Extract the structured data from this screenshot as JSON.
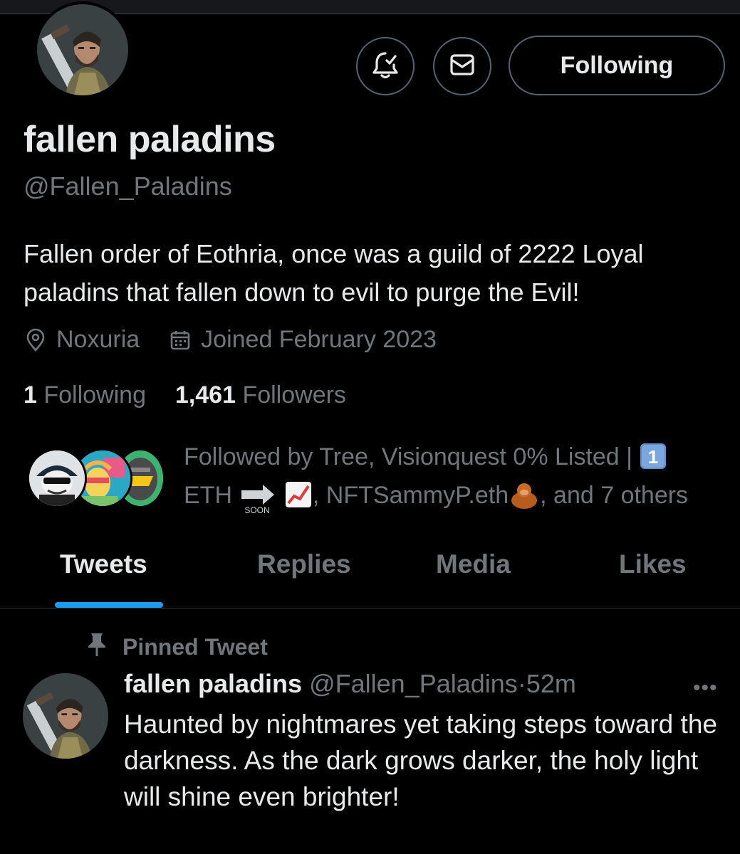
{
  "profile": {
    "name": "fallen paladins",
    "handle": "@Fallen_Paladins",
    "bio": "Fallen order of Eothria, once was a guild of 2222 Loyal paladins that fallen down to evil to purge the Evil!",
    "location": "Noxuria",
    "joined": "Joined February 2023",
    "following_count": "1",
    "following_label": "Following",
    "followers_count": "1,461",
    "followers_label": "Followers"
  },
  "actions": {
    "follow_label": "Following",
    "notify_icon": "bell-check-icon",
    "message_icon": "envelope-icon"
  },
  "followed_by": {
    "line1_text": "Followed by Tree, Visionquest 0% Listed |",
    "badge": "1",
    "eth_text": "ETH",
    "soon_text": "SOON",
    "nft_text": ", NFTSammyP.eth",
    "others_text": ", and 7 others"
  },
  "tabs": [
    "Tweets",
    "Replies",
    "Media",
    "Likes"
  ],
  "active_tab": "Tweets",
  "pinned_tweet": {
    "label": "Pinned Tweet",
    "author": "fallen paladins",
    "handle": "@Fallen_Paladins",
    "dot": "·",
    "time": "52m",
    "more": "•••",
    "text": "Haunted by nightmares yet taking steps toward the darkness. As the dark grows darker, the holy light will shine even brighter!"
  },
  "colors": {
    "background": "#000000",
    "text_primary": "#e7e9ea",
    "text_secondary": "#71767b",
    "accent": "#1d9bf0",
    "border": "#536471"
  }
}
